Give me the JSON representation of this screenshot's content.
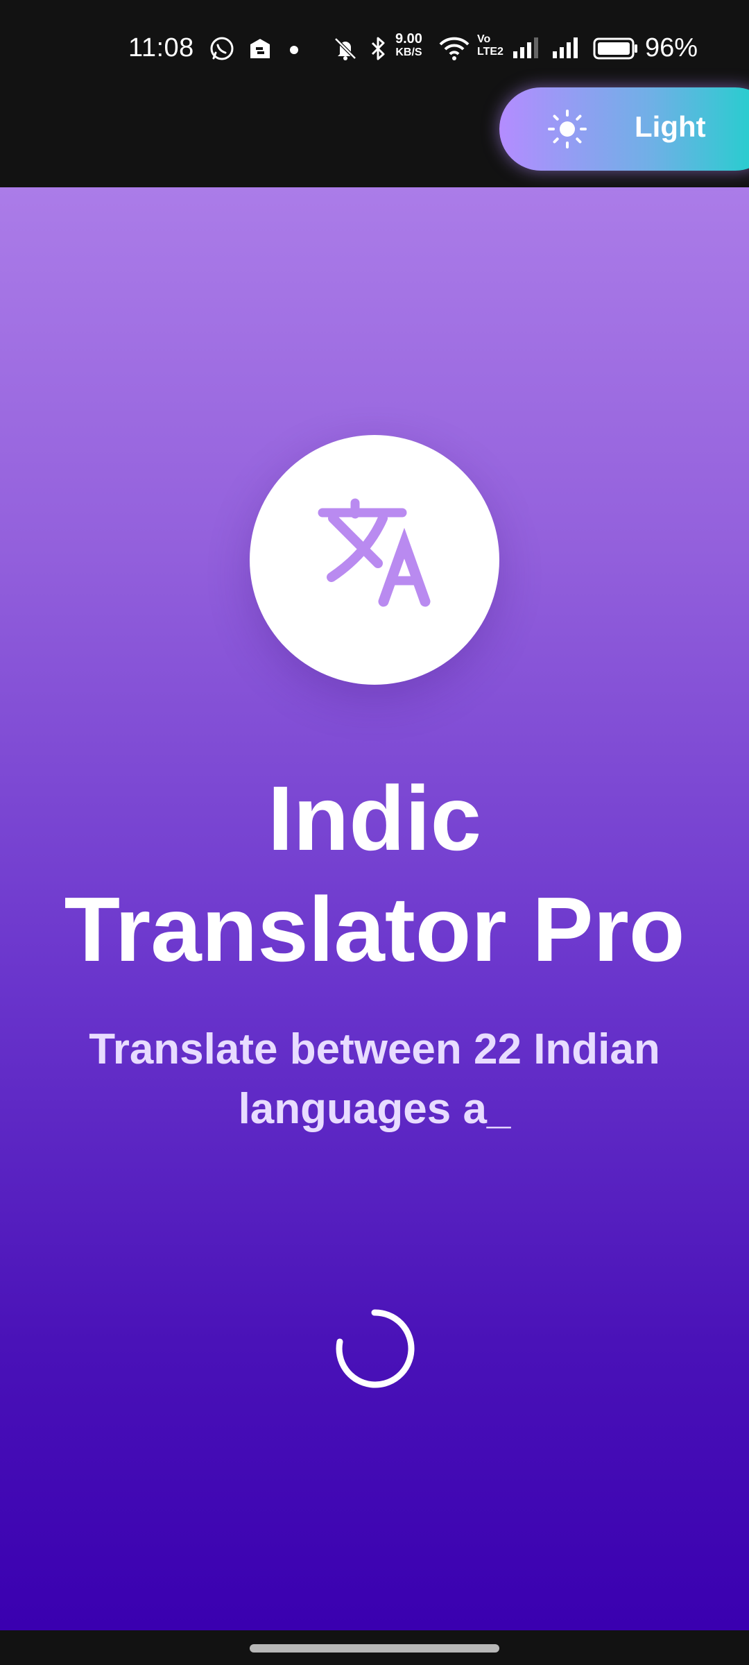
{
  "status_bar": {
    "time": "11:08",
    "speed_value": "9.00",
    "speed_unit": "KB/S",
    "volte_top": "Vo",
    "volte_bottom": "LTE2",
    "battery_percent": "96%",
    "icons": [
      "whatsapp-icon",
      "app-notification-icon",
      "dot-icon",
      "mute-bell-icon",
      "bluetooth-icon",
      "wifi-icon",
      "signal-icon",
      "signal-icon",
      "battery-icon"
    ]
  },
  "theme_toggle": {
    "label": "Light",
    "icon": "sun-icon",
    "gradient_start": "#b48cff",
    "gradient_end": "#17d4c9"
  },
  "splash": {
    "logo_icon": "translate-icon",
    "title_line1": "Indic",
    "title_line2": "Translator Pro",
    "subtitle_line1": "Translate between 22 Indian",
    "subtitle_line2": "languages a_",
    "loading_indicator": "spinner",
    "gradient_top": "#ab7ce8",
    "gradient_bottom": "#3a00b0",
    "accent": "#b98af0"
  }
}
